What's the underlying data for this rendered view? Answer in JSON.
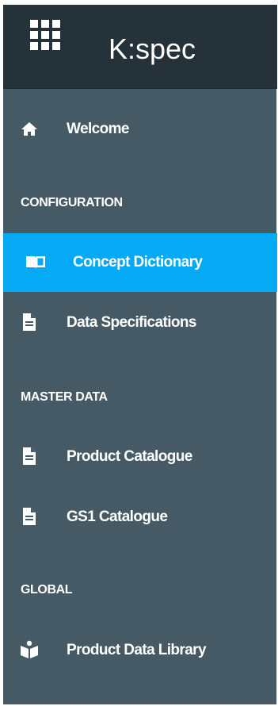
{
  "app": {
    "title": "K:spec",
    "menu_icon": "apps-grid-icon"
  },
  "colors": {
    "header_bg": "#263239",
    "sidebar_bg": "#465a65",
    "active_bg": "#06a9f3",
    "text": "#ffffff"
  },
  "nav": {
    "welcome": {
      "label": "Welcome",
      "icon": "home-icon"
    },
    "sections": [
      {
        "title": "CONFIGURATION",
        "items": [
          {
            "label": "Concept Dictionary",
            "icon": "book-icon",
            "active": true
          },
          {
            "label": "Data Specifications",
            "icon": "document-icon",
            "active": false
          }
        ]
      },
      {
        "title": "MASTER DATA",
        "items": [
          {
            "label": "Product Catalogue",
            "icon": "document-icon",
            "active": false
          },
          {
            "label": "GS1 Catalogue",
            "icon": "document-icon",
            "active": false
          }
        ]
      },
      {
        "title": "GLOBAL",
        "items": [
          {
            "label": "Product Data Library",
            "icon": "package-library-icon",
            "active": false
          }
        ]
      }
    ]
  }
}
